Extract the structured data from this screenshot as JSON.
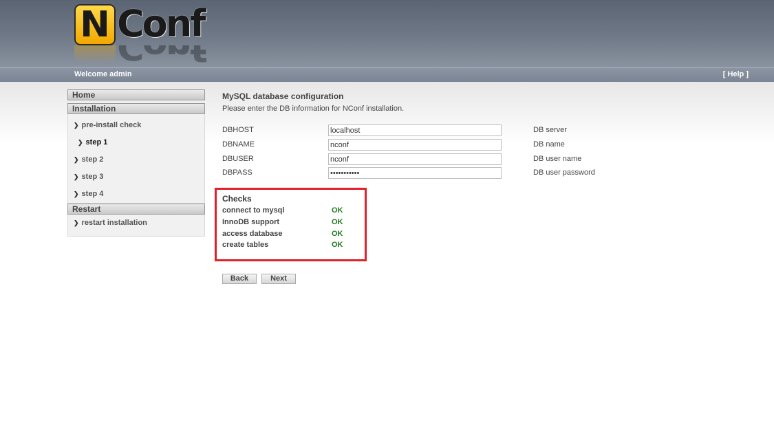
{
  "header": {
    "logo_letter": "N",
    "logo_text": "Conf",
    "welcome": "Welcome admin",
    "help": "[ Help ]"
  },
  "sidebar": {
    "home": "Home",
    "installation": "Installation",
    "install_items": [
      {
        "label": "pre-install check"
      },
      {
        "label": "step 1",
        "active": true
      },
      {
        "label": "step 2"
      },
      {
        "label": "step 3"
      },
      {
        "label": "step 4"
      }
    ],
    "restart": "Restart",
    "restart_items": [
      {
        "label": "restart installation"
      }
    ]
  },
  "main": {
    "title": "MySQL database configuration",
    "description": "Please enter the DB information for NConf installation.",
    "fields": [
      {
        "label": "DBHOST",
        "value": "localhost",
        "hint": "DB server"
      },
      {
        "label": "DBNAME",
        "value": "nconf",
        "hint": "DB name"
      },
      {
        "label": "DBUSER",
        "value": "nconf",
        "hint": "DB user name"
      },
      {
        "label": "DBPASS",
        "value": "nconfpasswd",
        "hint": "DB user password"
      }
    ],
    "checks_title": "Checks",
    "checks": [
      {
        "label": "connect to mysql",
        "status": "OK"
      },
      {
        "label": "InnoDB support",
        "status": "OK"
      },
      {
        "label": "access database",
        "status": "OK"
      },
      {
        "label": "create tables",
        "status": "OK"
      }
    ],
    "back_label": "Back",
    "next_label": "Next"
  },
  "colors": {
    "highlight_border": "#e0202a",
    "ok_green": "#1d7a1d",
    "header_bg": "#6f7987"
  }
}
